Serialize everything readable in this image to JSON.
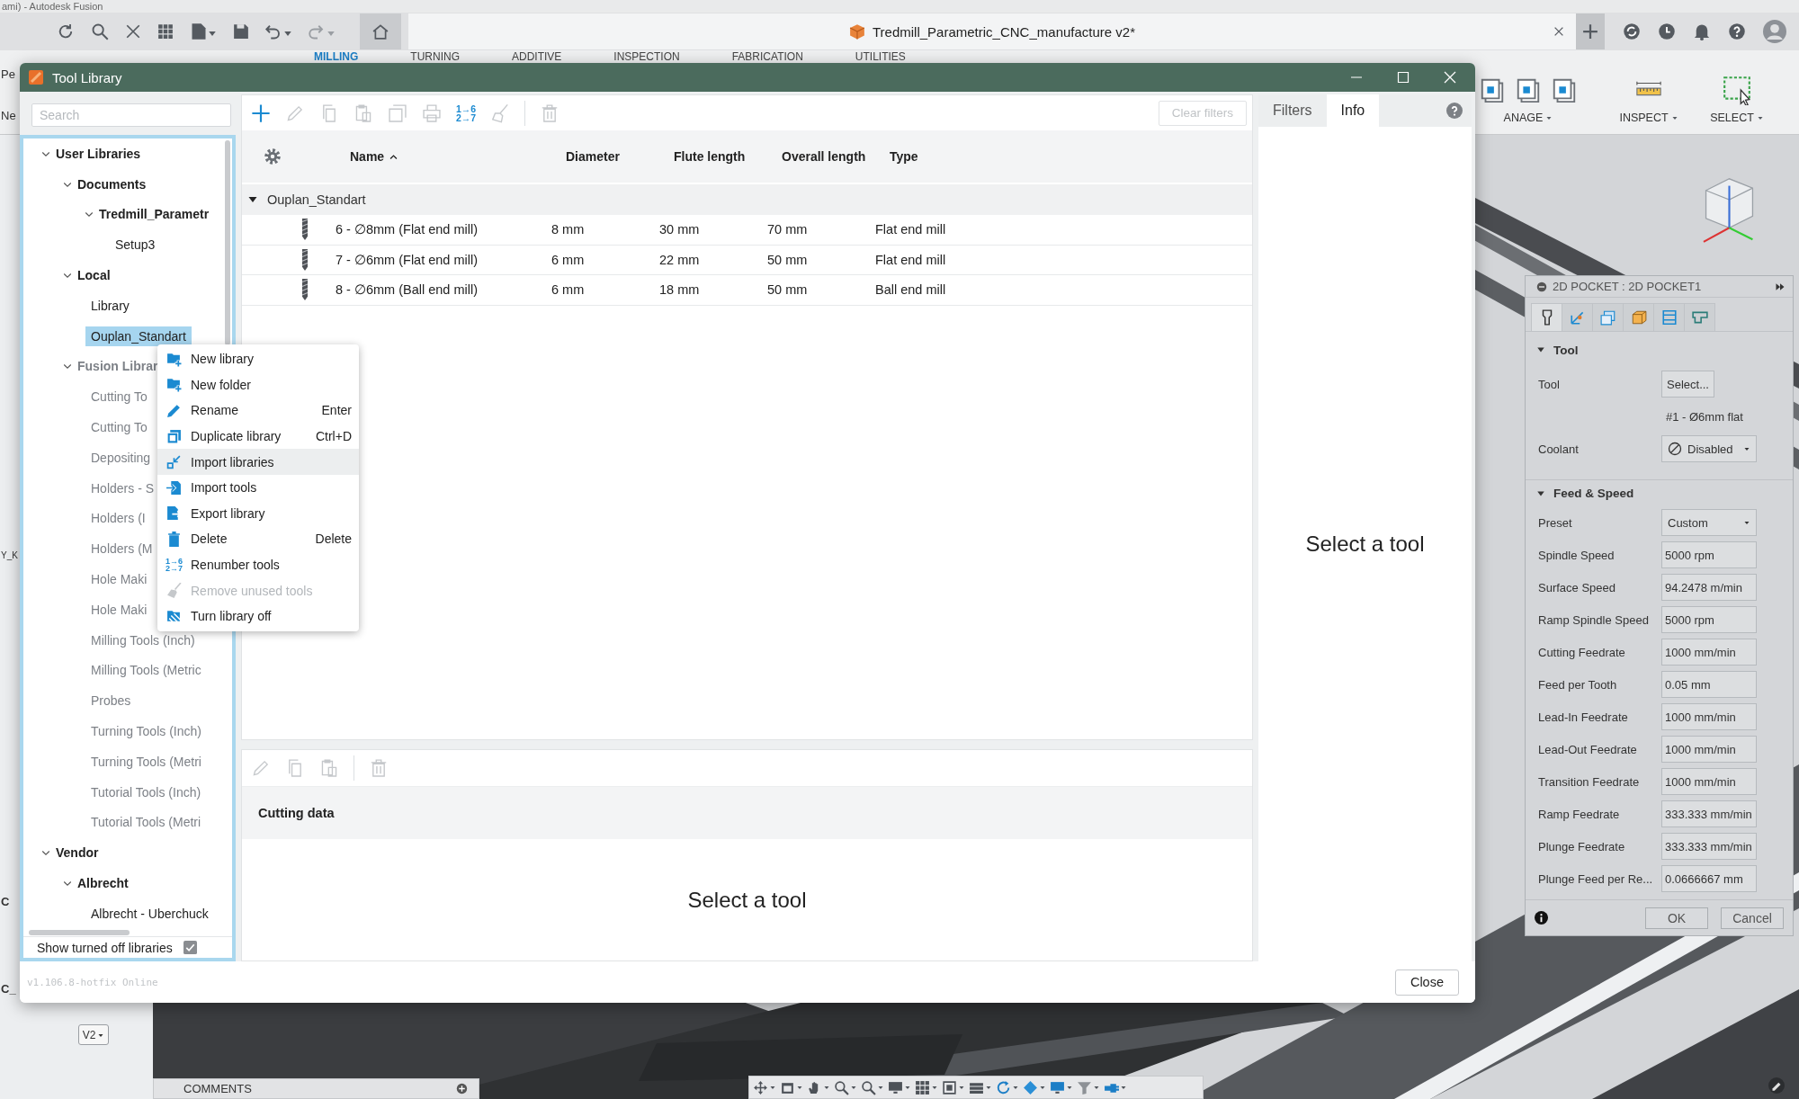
{
  "app": {
    "title": "ami) - Autodesk Fusion",
    "document_tab": {
      "title": "Tredmill_Parametric_CNC_manufacture v2*"
    },
    "ribbon_tabs": [
      {
        "label": "MILLING",
        "selected": true
      },
      {
        "label": "TURNING",
        "selected": false
      },
      {
        "label": "ADDITIVE",
        "selected": false
      },
      {
        "label": "INSPECTION",
        "selected": false
      },
      {
        "label": "FABRICATION",
        "selected": false
      },
      {
        "label": "UTILITIES",
        "selected": false
      }
    ],
    "ribbon_groups": [
      {
        "label": "ANAGE",
        "kind": "manage"
      },
      {
        "label": "INSPECT",
        "kind": "inspect"
      },
      {
        "label": "SELECT",
        "kind": "select"
      }
    ],
    "browser_fragments": [
      "Pe",
      "Ne",
      "Y_K",
      "C",
      "C_"
    ],
    "version_picker": "V2",
    "comments": "COMMENTS"
  },
  "dialog": {
    "title": "Tool Library",
    "search": {
      "placeholder": "Search"
    },
    "tree": [
      {
        "label": "User Libraries",
        "expanded": true,
        "selected": false,
        "off": false,
        "children": [
          {
            "label": "Documents",
            "expanded": true,
            "selected": false,
            "off": false,
            "children": [
              {
                "label": "Tredmill_Parametr",
                "expanded": true,
                "selected": false,
                "off": false,
                "children": [
                  {
                    "label": "Setup3",
                    "selected": false,
                    "off": false
                  }
                ]
              }
            ]
          },
          {
            "label": "Local",
            "expanded": true,
            "selected": false,
            "off": false,
            "children": [
              {
                "label": "Library",
                "selected": false,
                "off": false
              },
              {
                "label": "Ouplan_Standart",
                "selected": true,
                "off": false
              }
            ]
          },
          {
            "label": "Fusion Librar",
            "expanded": true,
            "selected": false,
            "off": true,
            "children": [
              {
                "label": "Cutting To",
                "selected": false,
                "off": true
              },
              {
                "label": "Cutting To",
                "selected": false,
                "off": true
              },
              {
                "label": "Depositing",
                "selected": false,
                "off": true
              },
              {
                "label": "Holders - S",
                "selected": false,
                "off": true
              },
              {
                "label": "Holders (I",
                "selected": false,
                "off": true
              },
              {
                "label": "Holders (M",
                "selected": false,
                "off": true
              },
              {
                "label": "Hole Maki",
                "selected": false,
                "off": true
              },
              {
                "label": "Hole Maki",
                "selected": false,
                "off": true
              },
              {
                "label": "Milling Tools (Inch)",
                "selected": false,
                "off": true
              },
              {
                "label": "Milling Tools (Metric",
                "selected": false,
                "off": true
              },
              {
                "label": "Probes",
                "selected": false,
                "off": true
              },
              {
                "label": "Turning Tools (Inch)",
                "selected": false,
                "off": true
              },
              {
                "label": "Turning Tools (Metri",
                "selected": false,
                "off": true
              },
              {
                "label": "Tutorial Tools (Inch)",
                "selected": false,
                "off": true
              },
              {
                "label": "Tutorial Tools (Metri",
                "selected": false,
                "off": true
              }
            ]
          }
        ]
      },
      {
        "label": "Vendor",
        "expanded": true,
        "selected": false,
        "off": false,
        "children": [
          {
            "label": "Albrecht",
            "expanded": true,
            "selected": false,
            "off": false,
            "children": [
              {
                "label": "Albrecht - Uberchuck",
                "selected": false,
                "off": false
              }
            ]
          }
        ]
      }
    ],
    "show_turned_off": {
      "label": "Show turned off libraries",
      "checked": true
    },
    "toolbar": [
      {
        "kind": "add",
        "disabled": false
      },
      {
        "kind": "edit",
        "disabled": true
      },
      {
        "kind": "copy",
        "disabled": true
      },
      {
        "kind": "paste",
        "disabled": true
      },
      {
        "kind": "duplicate",
        "disabled": true
      },
      {
        "kind": "print",
        "disabled": true
      },
      {
        "kind": "renumber",
        "disabled": false,
        "glyph": [
          "1→6",
          "2→7"
        ]
      },
      {
        "kind": "clean",
        "disabled": true
      },
      {
        "kind": "separator"
      },
      {
        "kind": "delete",
        "disabled": true
      }
    ],
    "clear_filters": {
      "label": "Clear filters",
      "disabled": true
    },
    "columns": [
      {
        "label": "Name",
        "sorted": true
      },
      {
        "label": "Diameter",
        "sorted": false
      },
      {
        "label": "Flute length",
        "sorted": false
      },
      {
        "label": "Overall length",
        "sorted": false
      },
      {
        "label": "Type",
        "sorted": false
      }
    ],
    "group": {
      "name": "Ouplan_Standart",
      "expanded": true
    },
    "rows": [
      {
        "cells": [
          "6 - ∅8mm (Flat end mill)",
          "8 mm",
          "30 mm",
          "70 mm",
          "Flat end mill"
        ]
      },
      {
        "cells": [
          "7 - ∅6mm (Flat end mill)",
          "6 mm",
          "22 mm",
          "50 mm",
          "Flat end mill"
        ]
      },
      {
        "cells": [
          "8 - ∅6mm (Ball end mill)",
          "6 mm",
          "18 mm",
          "50 mm",
          "Ball end mill"
        ]
      }
    ],
    "details": {
      "toolbar": [
        {
          "kind": "edit",
          "disabled": true
        },
        {
          "kind": "copy",
          "disabled": true
        },
        {
          "kind": "paste",
          "disabled": true
        },
        {
          "kind": "separator"
        },
        {
          "kind": "delete",
          "disabled": true
        }
      ],
      "section": "Cutting data",
      "empty_text": "Select a tool"
    },
    "info": {
      "tabs": [
        {
          "label": "Filters",
          "selected": false
        },
        {
          "label": "Info",
          "selected": true
        }
      ],
      "empty_text": "Select a tool"
    },
    "version": "v1.106.8-hotfix Online",
    "close": "Close"
  },
  "context_menu": {
    "items": [
      {
        "kind": "folder-plus",
        "label": "New library",
        "disabled": false,
        "hovered": false
      },
      {
        "kind": "folder-plus",
        "label": "New folder",
        "disabled": false,
        "hovered": false
      },
      {
        "kind": "pencil",
        "label": "Rename",
        "shortcut": "Enter",
        "disabled": false,
        "hovered": false
      },
      {
        "kind": "duplicate",
        "label": "Duplicate library",
        "shortcut": "Ctrl+D",
        "disabled": false,
        "hovered": false
      },
      {
        "kind": "import-libraries",
        "label": "Import libraries",
        "disabled": false,
        "hovered": true
      },
      {
        "kind": "import",
        "label": "Import tools",
        "disabled": false,
        "hovered": false
      },
      {
        "kind": "export",
        "label": "Export library",
        "disabled": false,
        "hovered": false
      },
      {
        "kind": "trash",
        "label": "Delete",
        "shortcut": "Delete",
        "disabled": false,
        "hovered": false
      },
      {
        "kind": "renumber",
        "glyph": [
          "1→6",
          "2→7"
        ],
        "label": "Renumber tools",
        "disabled": false,
        "hovered": false
      },
      {
        "kind": "broom",
        "label": "Remove unused tools",
        "disabled": true,
        "hovered": false
      },
      {
        "kind": "hatched",
        "label": "Turn library off",
        "disabled": false,
        "hovered": false
      }
    ]
  },
  "cam_panel": {
    "title": "2D POCKET : 2D POCKET1",
    "tabs": [
      {
        "kind": "tool",
        "selected": true
      },
      {
        "kind": "geometry",
        "selected": false
      },
      {
        "kind": "heights",
        "selected": false
      },
      {
        "kind": "passes",
        "selected": false
      },
      {
        "kind": "linking",
        "selected": false
      },
      {
        "kind": "post",
        "selected": false
      }
    ],
    "sections": [
      {
        "title": "Tool",
        "expanded": true,
        "rows": [
          {
            "kind": "button",
            "label": "Tool",
            "value": "Select..."
          },
          {
            "kind": "note",
            "value": "#1 - Ø6mm flat"
          },
          {
            "kind": "icon-dropdown",
            "label": "Coolant",
            "value": "Disabled"
          }
        ]
      },
      {
        "title": "Feed & Speed",
        "expanded": true,
        "rows": [
          {
            "kind": "dropdown",
            "label": "Preset",
            "value": "Custom"
          },
          {
            "kind": "field",
            "label": "Spindle Speed",
            "value": "5000 rpm"
          },
          {
            "kind": "field",
            "label": "Surface Speed",
            "value": "94.2478 m/min"
          },
          {
            "kind": "field",
            "label": "Ramp Spindle Speed",
            "value": "5000 rpm"
          },
          {
            "kind": "field",
            "label": "Cutting Feedrate",
            "value": "1000 mm/min"
          },
          {
            "kind": "field",
            "label": "Feed per Tooth",
            "value": "0.05 mm"
          },
          {
            "kind": "field",
            "label": "Lead-In Feedrate",
            "value": "1000 mm/min"
          },
          {
            "kind": "field",
            "label": "Lead-Out Feedrate",
            "value": "1000 mm/min"
          },
          {
            "kind": "field",
            "label": "Transition Feedrate",
            "value": "1000 mm/min"
          },
          {
            "kind": "field",
            "label": "Ramp Feedrate",
            "value": "333.333 mm/min"
          },
          {
            "kind": "field",
            "label": "Plunge Feedrate",
            "value": "333.333 mm/min"
          },
          {
            "kind": "field",
            "label": "Plunge Feed per Re...",
            "value": "0.0666667 mm"
          }
        ]
      }
    ],
    "ok": "OK",
    "cancel": "Cancel"
  }
}
